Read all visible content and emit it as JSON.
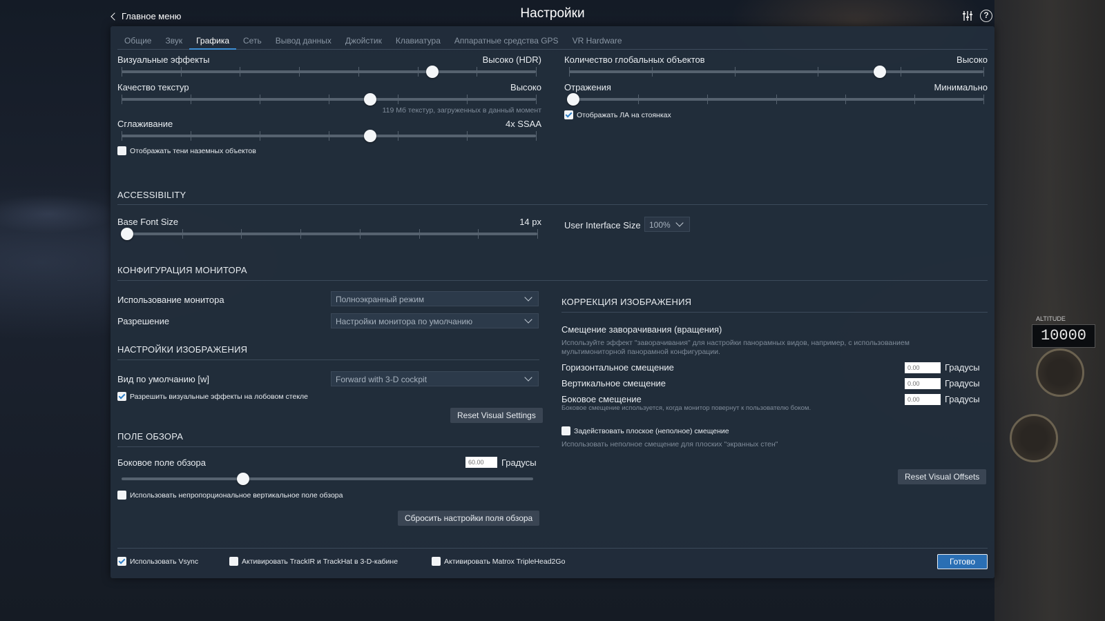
{
  "header": {
    "back_label": "Главное меню",
    "title": "Настройки",
    "icons": [
      "sliders-icon",
      "help-icon"
    ]
  },
  "tabs": [
    {
      "label": "Общие",
      "active": false
    },
    {
      "label": "Звук",
      "active": false
    },
    {
      "label": "Графика",
      "active": true
    },
    {
      "label": "Сеть",
      "active": false
    },
    {
      "label": "Вывод данных",
      "active": false
    },
    {
      "label": "Джойстик",
      "active": false
    },
    {
      "label": "Клавиатура",
      "active": false
    },
    {
      "label": "Аппаратные средства GPS",
      "active": false
    },
    {
      "label": "VR Hardware",
      "active": false
    }
  ],
  "graphics": {
    "visual_effects": {
      "label": "Визуальные эффекты",
      "value": "Высоко (HDR)",
      "level": 0.75,
      "ticks": 7
    },
    "texture_quality": {
      "label": "Качество текстур",
      "value": "Высоко",
      "level": 0.6,
      "ticks": 6,
      "note": "119 Мб текстур, загруженных в данный момент"
    },
    "antialiasing": {
      "label": "Сглаживание",
      "value": "4x SSAA",
      "level": 0.6,
      "ticks": 6
    },
    "ground_shadows": {
      "label": "Отображать тени наземных объектов",
      "checked": false
    },
    "global_objects": {
      "label": "Количество глобальных объектов",
      "value": "Высоко",
      "level": 0.75,
      "ticks": 5
    },
    "reflections": {
      "label": "Отражения",
      "value": "Минимально",
      "level": 0.0,
      "ticks": 6
    },
    "parked_aircraft": {
      "label": "Отображать ЛА на стоянках",
      "checked": true
    }
  },
  "accessibility": {
    "title": "ACCESSIBILITY",
    "base_font": {
      "label": "Base Font Size",
      "value": "14 px",
      "level": 0.0,
      "ticks": 7
    },
    "ui_size": {
      "label": "User Interface Size",
      "value": "100%"
    }
  },
  "monitor": {
    "title": "КОНФИГУРАЦИЯ МОНИТОРА",
    "usage": {
      "label": "Использование монитора",
      "value": "Полноэкранный режим"
    },
    "resolution": {
      "label": "Разрешение",
      "value": "Настройки монитора по умолчанию"
    }
  },
  "image_settings": {
    "title": "НАСТРОЙКИ ИЗОБРАЖЕНИЯ",
    "default_view": {
      "label": "Вид по умолчанию [w]",
      "value": "Forward with 3-D cockpit"
    },
    "windshield": {
      "label": "Разрешить визуальные эффекты на лобовом стекле",
      "checked": true
    },
    "reset_label": "Reset Visual Settings"
  },
  "fov": {
    "title": "ПОЛЕ ОБЗОРА",
    "lateral": {
      "label": "Боковое поле обзора",
      "value": "60.00",
      "unit": "Градусы",
      "level": 0.295
    },
    "nonprop": {
      "label": "Использовать непропорциональное вертикальное поле обзора",
      "checked": false
    },
    "reset_label": "Сбросить настройки поля обзора"
  },
  "correction": {
    "title": "КОРРЕКЦИЯ ИЗОБРАЖЕНИЯ",
    "subtitle": "Смещение заворачивания (вращения)",
    "desc": [
      "Используйте эффект \"заворачивания\" для настройки панорамных видов, например, с использованием",
      "мультимониторной панорамной конфигурации."
    ],
    "horizontal": {
      "label": "Горизонтальное смещение",
      "value": "0.00",
      "unit": "Градусы"
    },
    "vertical": {
      "label": "Вертикальное смещение",
      "value": "0.00",
      "unit": "Градусы"
    },
    "lateral": {
      "label": "Боковое смещение",
      "value": "0.00",
      "unit": "Градусы"
    },
    "lateral_hint": "Боковое смещение используется, когда монитор повернут к пользователю боком.",
    "flat": {
      "label": "Задействовать плоское (неполное) смещение",
      "checked": false
    },
    "flat_hint": "Использовать неполное смещение для плоских \"экранных стен\"",
    "reset_label": "Reset Visual Offsets"
  },
  "footer": {
    "vsync": {
      "label": "Использовать Vsync",
      "checked": true
    },
    "trackir": {
      "label": "Активировать TrackIR и TrackHat в 3-D-кабине",
      "checked": false
    },
    "matrox": {
      "label": "Активировать Matrox TripleHead2Go",
      "checked": false
    },
    "done_label": "Готово"
  },
  "background": {
    "altitude_label": "ALTITUDE",
    "altitude_value": "10000"
  },
  "colors": {
    "panel": "#222d3b",
    "accent": "#3d8fd6",
    "primary_button": "#2a6fb4"
  }
}
